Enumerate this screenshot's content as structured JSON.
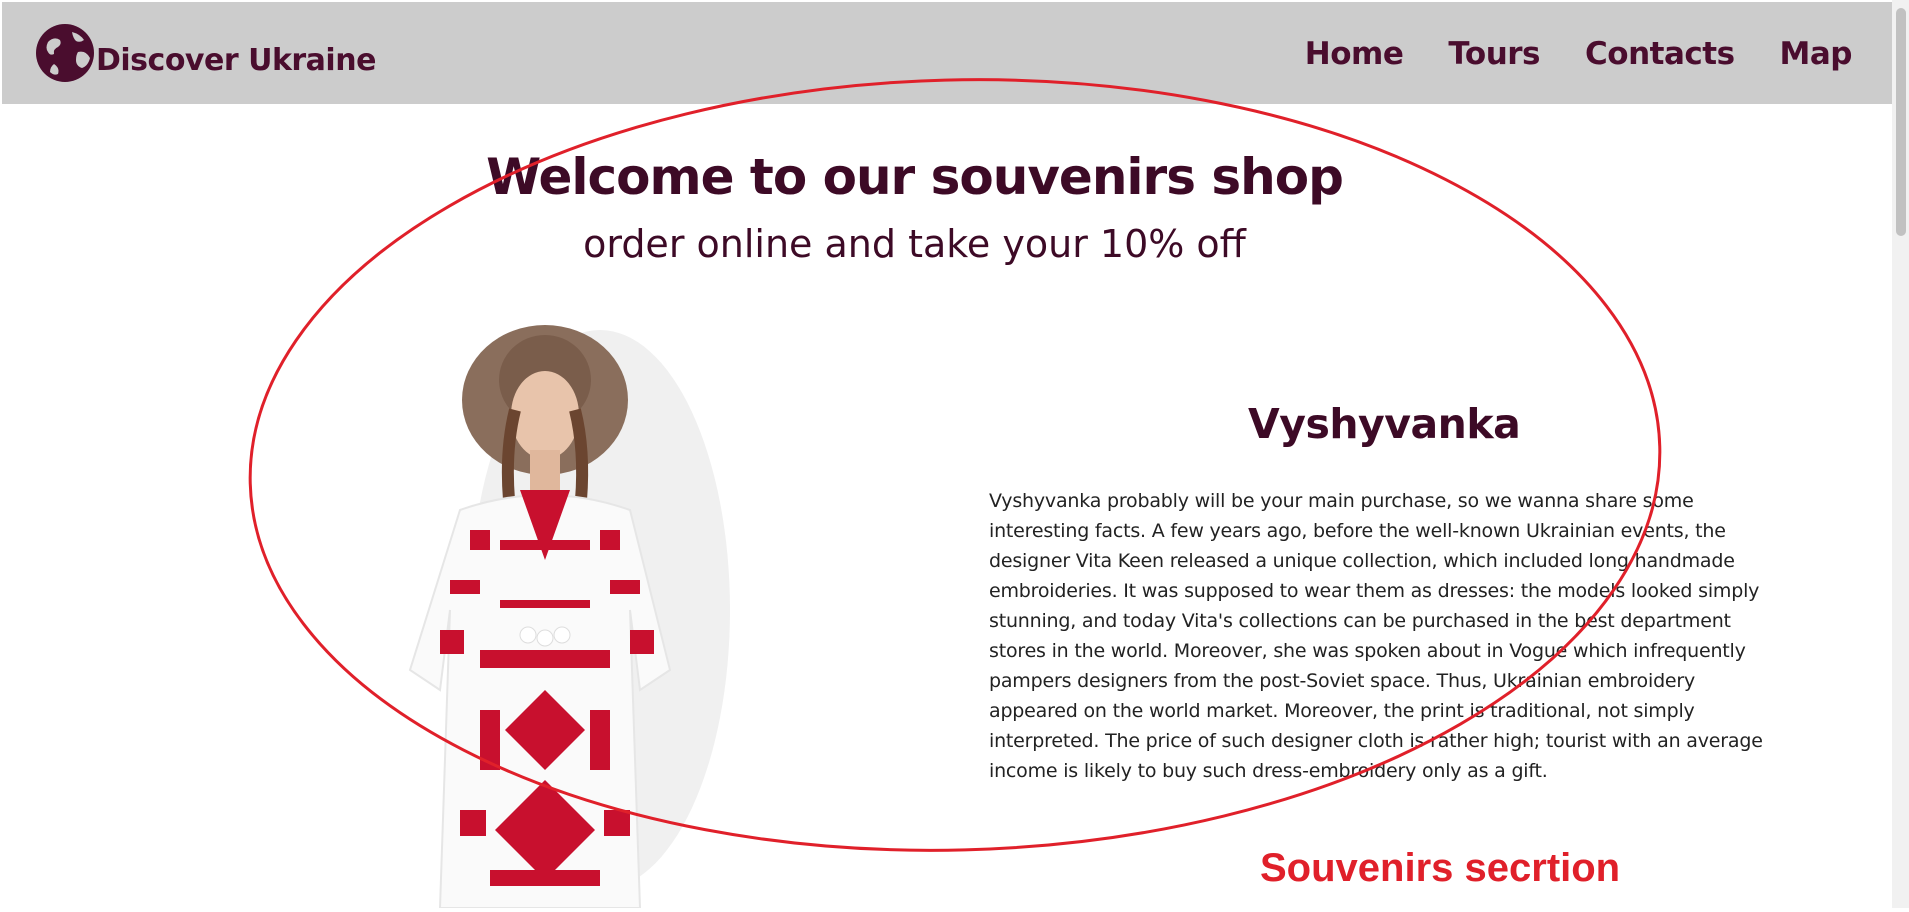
{
  "header": {
    "logo_text": "Discover Ukraine",
    "nav": [
      "Home",
      "Tours",
      "Contacts",
      "Map"
    ],
    "background": "#cccccc",
    "text_color": "#4a0d2e"
  },
  "hero": {
    "title": "Welcome to our souvenirs shop",
    "subtitle": "order online and take your 10% off"
  },
  "product": {
    "title": "Vyshyvanka",
    "description": "Vyshyvanka probably will be your main purchase, so we wanna share some interesting facts. A few years ago, before the well-known Ukrainian events, the designer Vita Keen released a unique collection, which included long handmade embroideries. It was supposed to wear them as dresses: the models looked simply stunning, and today Vita's collections can be purchased in the best department stores in the world. Moreover, she was spoken about in Vogue which infrequently pampers designers from the post-Soviet space. Thus, Ukrainian embroidery appeared on the world market. Moreover, the print is traditional, not simply interpreted. The price of such designer cloth is rather high; tourist with an average income is likely to buy such dress-embroidery only as a gift.",
    "image_icon": "woman-in-embroidered-dress-image"
  },
  "annotation": {
    "label": "Souvenirs secrtion",
    "color": "#e0202a"
  }
}
